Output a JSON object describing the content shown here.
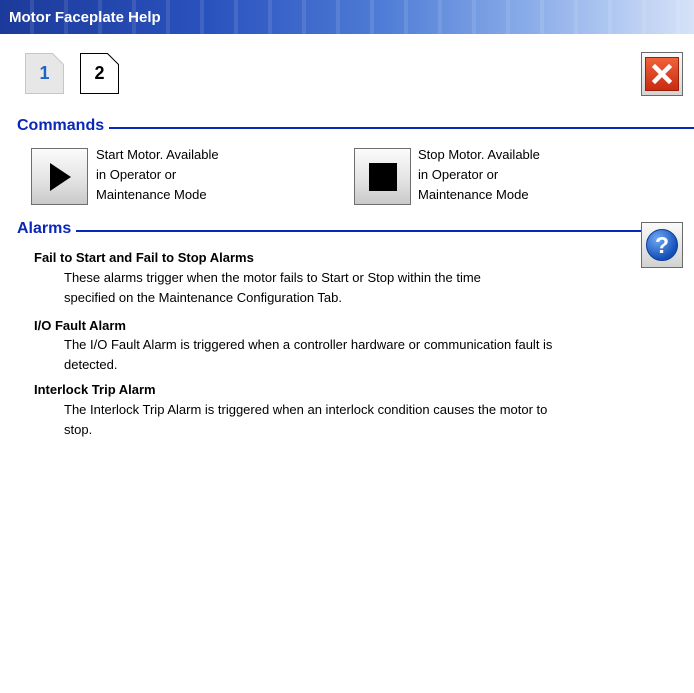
{
  "window": {
    "title": "Motor Faceplate Help"
  },
  "page_tabs": [
    {
      "label": "1"
    },
    {
      "label": "2"
    }
  ],
  "sections": {
    "commands": "Commands",
    "alarms": "Alarms"
  },
  "commands": [
    {
      "icon": "play-icon",
      "lines": [
        "Start Motor.  Available",
        "in Operator or",
        "Maintenance Mode"
      ]
    },
    {
      "icon": "stop-icon",
      "lines": [
        "Stop Motor.  Available",
        "in Operator or",
        "Maintenance Mode"
      ]
    }
  ],
  "alarms": [
    {
      "title": "Fail to Start and Fail to Stop Alarms",
      "lines": [
        "These alarms trigger when the motor fails to Start or Stop within the time",
        "specified on the Maintenance Configuration Tab."
      ]
    },
    {
      "title": "I/O Fault Alarm",
      "lines": [
        "The I/O Fault Alarm is triggered when a controller hardware or communication fault is",
        "detected."
      ]
    },
    {
      "title": "Interlock Trip Alarm",
      "lines": [
        "The Interlock Trip Alarm is triggered when an interlock condition causes the motor to",
        "stop."
      ]
    }
  ],
  "icons": {
    "close": "close-icon",
    "help": "help-icon"
  },
  "colors": {
    "section_blue": "#0a28b8",
    "tab_active_text": "#1d64c8",
    "close_red": "#d9381a"
  }
}
